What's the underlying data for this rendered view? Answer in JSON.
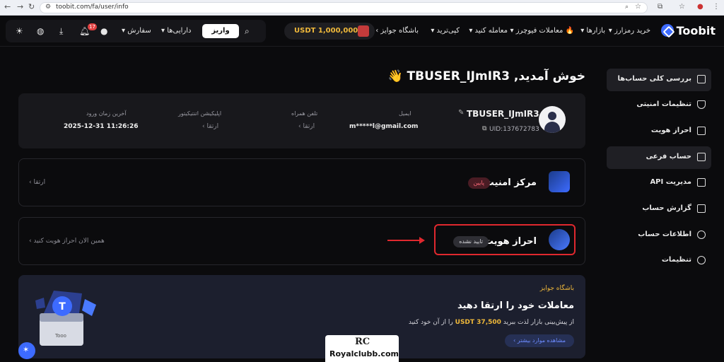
{
  "browser": {
    "url": "toobit.com/fa/user/info",
    "back": "←",
    "forward": "→",
    "reload": "↻"
  },
  "header": {
    "logo_text": "Toobit",
    "nav": [
      {
        "label": "خرید رمزارز ▾"
      },
      {
        "label": "بازارها ▾"
      },
      {
        "label": "🔥 معاملات فیوچرز ▾"
      },
      {
        "label": "معامله کنید ▾"
      },
      {
        "label": "کپی‌ترید ▾"
      },
      {
        "label": "باشگاه جوایز ›"
      }
    ],
    "prize_text": "USDT 1,000,000",
    "deposit_label": "واریز",
    "assets_label": "دارایی‌ها ▾",
    "orders_label": "سفارش ▾",
    "notif_count": "17"
  },
  "sidebar": {
    "items": [
      {
        "label": "بررسی کلی حساب‌ها",
        "active": true
      },
      {
        "label": "تنظیمات امنیتی",
        "active": false
      },
      {
        "label": "احراز هویت",
        "active": false
      },
      {
        "label": "حساب فرعی",
        "active": true
      },
      {
        "label": "مدیریت API",
        "active": false
      },
      {
        "label": "گزارش حساب",
        "active": false
      },
      {
        "label": "اطلاعات حساب",
        "active": false
      },
      {
        "label": "تنظیمات",
        "active": false
      }
    ]
  },
  "main": {
    "welcome": "خوش آمدید, TBUSER_IJmIR3 👋",
    "profile": {
      "username": "TBUSER_IJmIR3",
      "uid": "UID:137672783",
      "email_label": "ایمیل",
      "email_value": "m*****l@gmail.com",
      "phone_label": "تلفن همراه",
      "phone_value": "ارتقا ›",
      "auth_label": "اپلیکیشن اتنتیکیتور",
      "auth_value": "ارتقا ›",
      "last_login_label": "آخرین زمان ورود",
      "last_login_value": "2025-12-31 11:26:26"
    },
    "security": {
      "title": "مرکز امنیت",
      "badge": "پایین",
      "action": "ارتقا ›"
    },
    "identity": {
      "title": "احراز هویت",
      "badge": "تایید نشده",
      "action": "همین الان احراز هویت کنید ›"
    },
    "promo": {
      "subtitle": "باشگاه جوایز",
      "title": "معاملات خود را ارتقا دهید",
      "desc_prefix": "از پیش‌بینی بازار لذت ببرید",
      "desc_amount": "USDT 37,500",
      "desc_suffix": "را از آن خود کنید",
      "button": "مشاهده موارد بیشتر ›"
    }
  },
  "watermark": {
    "mark": "RC",
    "text": "Royalclubb.com"
  },
  "colors": {
    "accent": "#3d6bff",
    "gold": "#f0b93a",
    "danger": "#e0282e",
    "background": "#0b0b0d",
    "card": "#18181c"
  }
}
